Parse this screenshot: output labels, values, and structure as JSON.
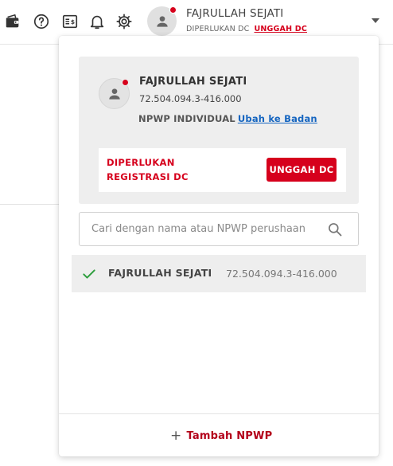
{
  "topbar": {
    "icons": [
      "wallet-icon",
      "help-icon",
      "billing-icon",
      "bell-icon",
      "gear-icon"
    ],
    "user_name": "FAJRULLAH SEJATI",
    "status_text": "DIPERLUKAN DC",
    "status_link": "UNGGAH DC"
  },
  "profile": {
    "name": "FAJRULLAH SEJATI",
    "npwp": "72.504.094.3-416.000",
    "type_label": "NPWP INDIVIDUAL",
    "change_link": "Ubah ke Badan",
    "alert_text": "DIPERLUKAN REGISTRASI DC",
    "alert_button": "UNGGAH DC"
  },
  "search": {
    "placeholder": "Cari dengan nama atau NPWP perushaan"
  },
  "companies": [
    {
      "name": "FAJRULLAH SEJATI",
      "npwp": "72.504.094.3-416.000",
      "selected": true
    }
  ],
  "footer": {
    "add_label": "Tambah NPWP"
  },
  "colors": {
    "accent_red": "#d6001c",
    "link_blue": "#1565c0",
    "check_green": "#2e9e3e"
  }
}
